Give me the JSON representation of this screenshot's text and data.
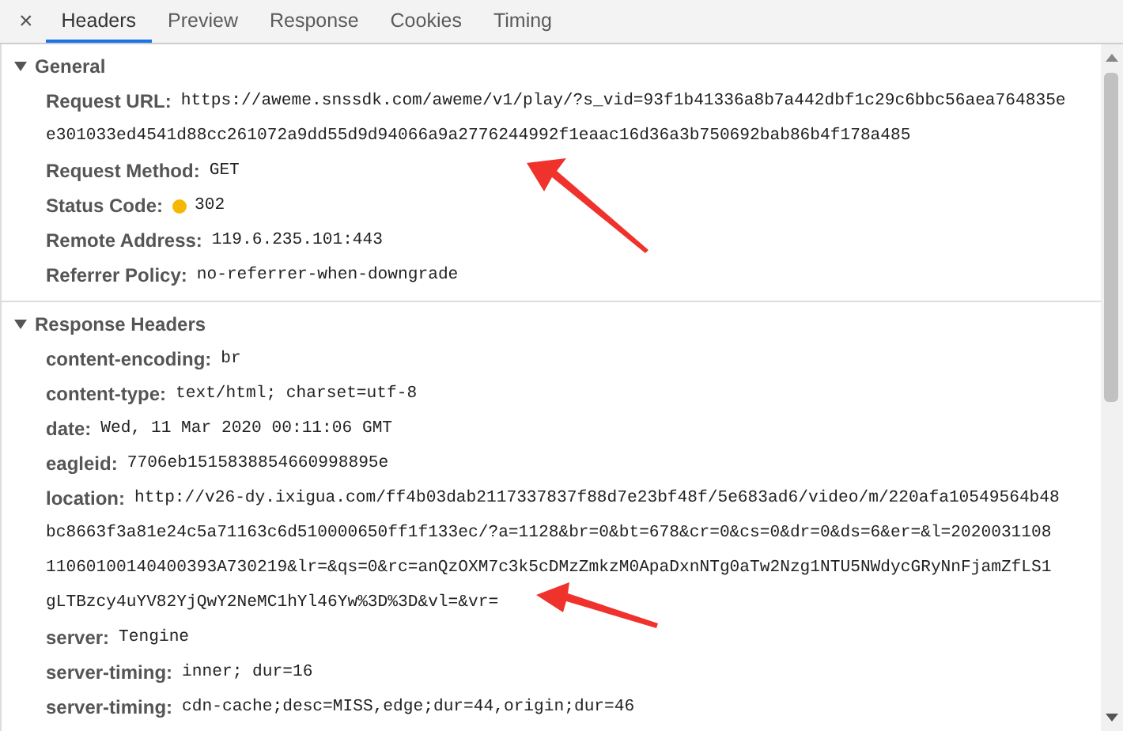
{
  "close": "×",
  "tabs": [
    {
      "label": "Headers",
      "selected": true
    },
    {
      "label": "Preview",
      "selected": false
    },
    {
      "label": "Response",
      "selected": false
    },
    {
      "label": "Cookies",
      "selected": false
    },
    {
      "label": "Timing",
      "selected": false
    }
  ],
  "sections": [
    {
      "title": "General",
      "expanded": true,
      "rows": [
        {
          "label": "Request URL:",
          "value": [
            "https://aweme.snssdk.com/aweme/v1/play/?s_vid=93f1b41336a8b7a442dbf1c29c6bbc56aea764835e",
            "e301033ed4541d88cc261072a9dd55d9d94066a9a2776244992f1eaac16d36a3b750692bab86b4f178a485"
          ]
        },
        {
          "label": "Request Method:",
          "value": [
            "GET"
          ]
        },
        {
          "label": "Status Code:",
          "color": "#f5b800",
          "value": [
            "302"
          ]
        },
        {
          "label": "Remote Address:",
          "value": [
            "119.6.235.101:443"
          ]
        },
        {
          "label": "Referrer Policy:",
          "value": [
            "no-referrer-when-downgrade"
          ]
        }
      ]
    },
    {
      "title": "Response Headers",
      "expanded": true,
      "rows": [
        {
          "label": "content-encoding:",
          "value": [
            "br"
          ]
        },
        {
          "label": "content-type:",
          "value": [
            "text/html; charset=utf-8"
          ]
        },
        {
          "label": "date:",
          "value": [
            "Wed, 11 Mar 2020 00:11:06 GMT"
          ]
        },
        {
          "label": "eagleid:",
          "value": [
            "7706eb1515838854660998895e"
          ]
        },
        {
          "label": "location:",
          "value": [
            "http://v26-dy.ixigua.com/ff4b03dab2117337837f88d7e23bf48f/5e683ad6/video/m/220afa10549564b48",
            "bc8663f3a81e24c5a71163c6d510000650ff1f133ec/?a=1128&br=0&bt=678&cr=0&cs=0&dr=0&ds=6&er=&l=2020031108",
            "11060100140400393A730219&lr=&qs=0&rc=anQzOXM7c3k5cDMzZmkzM0ApaDxnNTg0aTw2Nzg1NTU5NWdycGRyNnFjamZfLS1",
            "gLTBzcy4uYV82YjQwY2NeMC1hYl46Yw%3D%3D&vl=&vr="
          ]
        },
        {
          "label": "server:",
          "value": [
            "Tengine"
          ]
        },
        {
          "label": "server-timing:",
          "value": [
            "inner; dur=16"
          ]
        },
        {
          "label": "server-timing:",
          "value": [
            "cdn-cache;desc=MISS,edge;dur=44,origin;dur=46"
          ]
        }
      ]
    }
  ]
}
